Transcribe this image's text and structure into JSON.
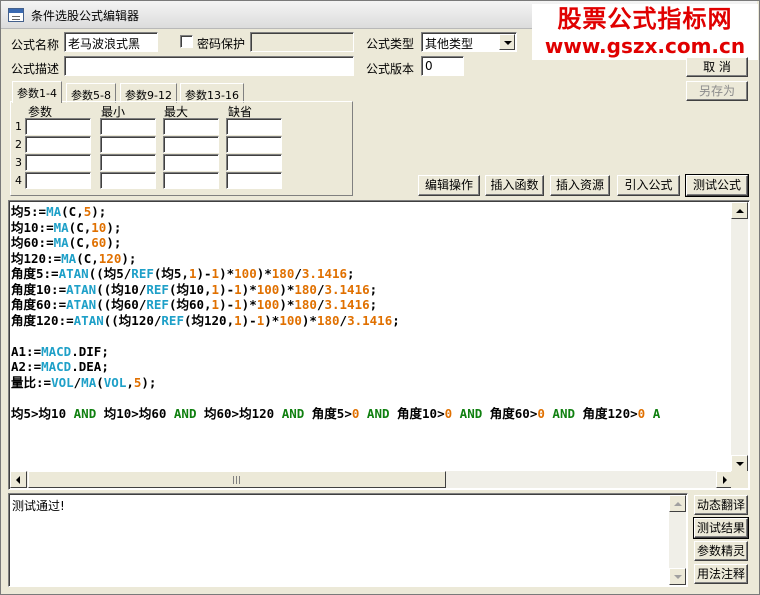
{
  "window": {
    "title": "条件选股公式编辑器"
  },
  "watermark": {
    "line1": "股票公式指标网",
    "line2": "www.gszx.com.cn"
  },
  "form": {
    "name_label": "公式名称",
    "name_value": "老马波浪式黑",
    "password_label": "密码保护",
    "password_checked": false,
    "password_value": "",
    "type_label": "公式类型",
    "type_value": "其他类型",
    "desc_label": "公式描述",
    "desc_value": "",
    "version_label": "公式版本",
    "version_value": "0"
  },
  "right_buttons": {
    "cancel": "取  消",
    "save_as": "另存为"
  },
  "tabs": [
    {
      "label": "参数1-4",
      "active": true
    },
    {
      "label": "参数5-8",
      "active": false
    },
    {
      "label": "参数9-12",
      "active": false
    },
    {
      "label": "参数13-16",
      "active": false
    }
  ],
  "param_table": {
    "headers": [
      "参数",
      "最小",
      "最大",
      "缺省"
    ],
    "row_numbers": [
      "1",
      "2",
      "3",
      "4"
    ]
  },
  "toolbar": {
    "edit_ops": "编辑操作",
    "insert_function": "插入函数",
    "insert_resource": "插入资源",
    "import_formula": "引入公式",
    "test_formula": "测试公式"
  },
  "code_lines": [
    [
      [
        "ident",
        "均5:="
      ],
      [
        "fn",
        "MA"
      ],
      [
        "op",
        "(C,"
      ],
      [
        "num",
        "5"
      ],
      [
        "op",
        ");"
      ]
    ],
    [
      [
        "ident",
        "均10:="
      ],
      [
        "fn",
        "MA"
      ],
      [
        "op",
        "(C,"
      ],
      [
        "num",
        "10"
      ],
      [
        "op",
        ");"
      ]
    ],
    [
      [
        "ident",
        "均60:="
      ],
      [
        "fn",
        "MA"
      ],
      [
        "op",
        "(C,"
      ],
      [
        "num",
        "60"
      ],
      [
        "op",
        ");"
      ]
    ],
    [
      [
        "ident",
        "均120:="
      ],
      [
        "fn",
        "MA"
      ],
      [
        "op",
        "(C,"
      ],
      [
        "num",
        "120"
      ],
      [
        "op",
        ");"
      ]
    ],
    [
      [
        "ident",
        "角度5:="
      ],
      [
        "fn",
        "ATAN"
      ],
      [
        "op",
        "((均5/"
      ],
      [
        "fn",
        "REF"
      ],
      [
        "op",
        "(均5,"
      ],
      [
        "num",
        "1"
      ],
      [
        "op",
        ")-"
      ],
      [
        "num",
        "1"
      ],
      [
        "op",
        ")*"
      ],
      [
        "num",
        "100"
      ],
      [
        "op",
        ")*"
      ],
      [
        "num",
        "180"
      ],
      [
        "op",
        "/"
      ],
      [
        "num",
        "3.1416"
      ],
      [
        "op",
        ";"
      ]
    ],
    [
      [
        "ident",
        "角度10:="
      ],
      [
        "fn",
        "ATAN"
      ],
      [
        "op",
        "((均10/"
      ],
      [
        "fn",
        "REF"
      ],
      [
        "op",
        "(均10,"
      ],
      [
        "num",
        "1"
      ],
      [
        "op",
        ")-"
      ],
      [
        "num",
        "1"
      ],
      [
        "op",
        ")*"
      ],
      [
        "num",
        "100"
      ],
      [
        "op",
        ")*"
      ],
      [
        "num",
        "180"
      ],
      [
        "op",
        "/"
      ],
      [
        "num",
        "3.1416"
      ],
      [
        "op",
        ";"
      ]
    ],
    [
      [
        "ident",
        "角度60:="
      ],
      [
        "fn",
        "ATAN"
      ],
      [
        "op",
        "((均60/"
      ],
      [
        "fn",
        "REF"
      ],
      [
        "op",
        "(均60,"
      ],
      [
        "num",
        "1"
      ],
      [
        "op",
        ")-"
      ],
      [
        "num",
        "1"
      ],
      [
        "op",
        ")*"
      ],
      [
        "num",
        "100"
      ],
      [
        "op",
        ")*"
      ],
      [
        "num",
        "180"
      ],
      [
        "op",
        "/"
      ],
      [
        "num",
        "3.1416"
      ],
      [
        "op",
        ";"
      ]
    ],
    [
      [
        "ident",
        "角度120:="
      ],
      [
        "fn",
        "ATAN"
      ],
      [
        "op",
        "((均120/"
      ],
      [
        "fn",
        "REF"
      ],
      [
        "op",
        "(均120,"
      ],
      [
        "num",
        "1"
      ],
      [
        "op",
        ")-"
      ],
      [
        "num",
        "1"
      ],
      [
        "op",
        ")*"
      ],
      [
        "num",
        "100"
      ],
      [
        "op",
        ")*"
      ],
      [
        "num",
        "180"
      ],
      [
        "op",
        "/"
      ],
      [
        "num",
        "3.1416"
      ],
      [
        "op",
        ";"
      ]
    ],
    [],
    [
      [
        "ident",
        "A1:="
      ],
      [
        "fn",
        "MACD"
      ],
      [
        "op",
        ".DIF;"
      ]
    ],
    [
      [
        "ident",
        "A2:="
      ],
      [
        "fn",
        "MACD"
      ],
      [
        "op",
        ".DEA;"
      ]
    ],
    [
      [
        "ident",
        "量比:="
      ],
      [
        "fn",
        "VOL"
      ],
      [
        "op",
        "/"
      ],
      [
        "fn",
        "MA"
      ],
      [
        "op",
        "("
      ],
      [
        "fn",
        "VOL"
      ],
      [
        "op",
        ","
      ],
      [
        "num",
        "5"
      ],
      [
        "op",
        ");"
      ]
    ],
    [],
    [
      [
        "ident",
        "均5>均10 "
      ],
      [
        "kw",
        "AND"
      ],
      [
        "ident",
        " 均10>均60 "
      ],
      [
        "kw",
        "AND"
      ],
      [
        "ident",
        " 均60>均120 "
      ],
      [
        "kw",
        "AND"
      ],
      [
        "ident",
        " 角度5>"
      ],
      [
        "num",
        "0"
      ],
      [
        "ident",
        " "
      ],
      [
        "kw",
        "AND"
      ],
      [
        "ident",
        " 角度10>"
      ],
      [
        "num",
        "0"
      ],
      [
        "ident",
        " "
      ],
      [
        "kw",
        "AND"
      ],
      [
        "ident",
        " 角度60>"
      ],
      [
        "num",
        "0"
      ],
      [
        "ident",
        " "
      ],
      [
        "kw",
        "AND"
      ],
      [
        "ident",
        " 角度120>"
      ],
      [
        "num",
        "0"
      ],
      [
        "ident",
        " "
      ],
      [
        "kw",
        "A"
      ]
    ]
  ],
  "token_colors": {
    "fn": "#1ea0c8",
    "num": "#e07000",
    "kw": "#108010",
    "ident": "#000000"
  },
  "output": {
    "text": "测试通过!"
  },
  "side_buttons": {
    "dynamic_translate": "动态翻译",
    "test_result": "测试结果",
    "param_wizard": "参数精灵",
    "usage_notes": "用法注释"
  }
}
